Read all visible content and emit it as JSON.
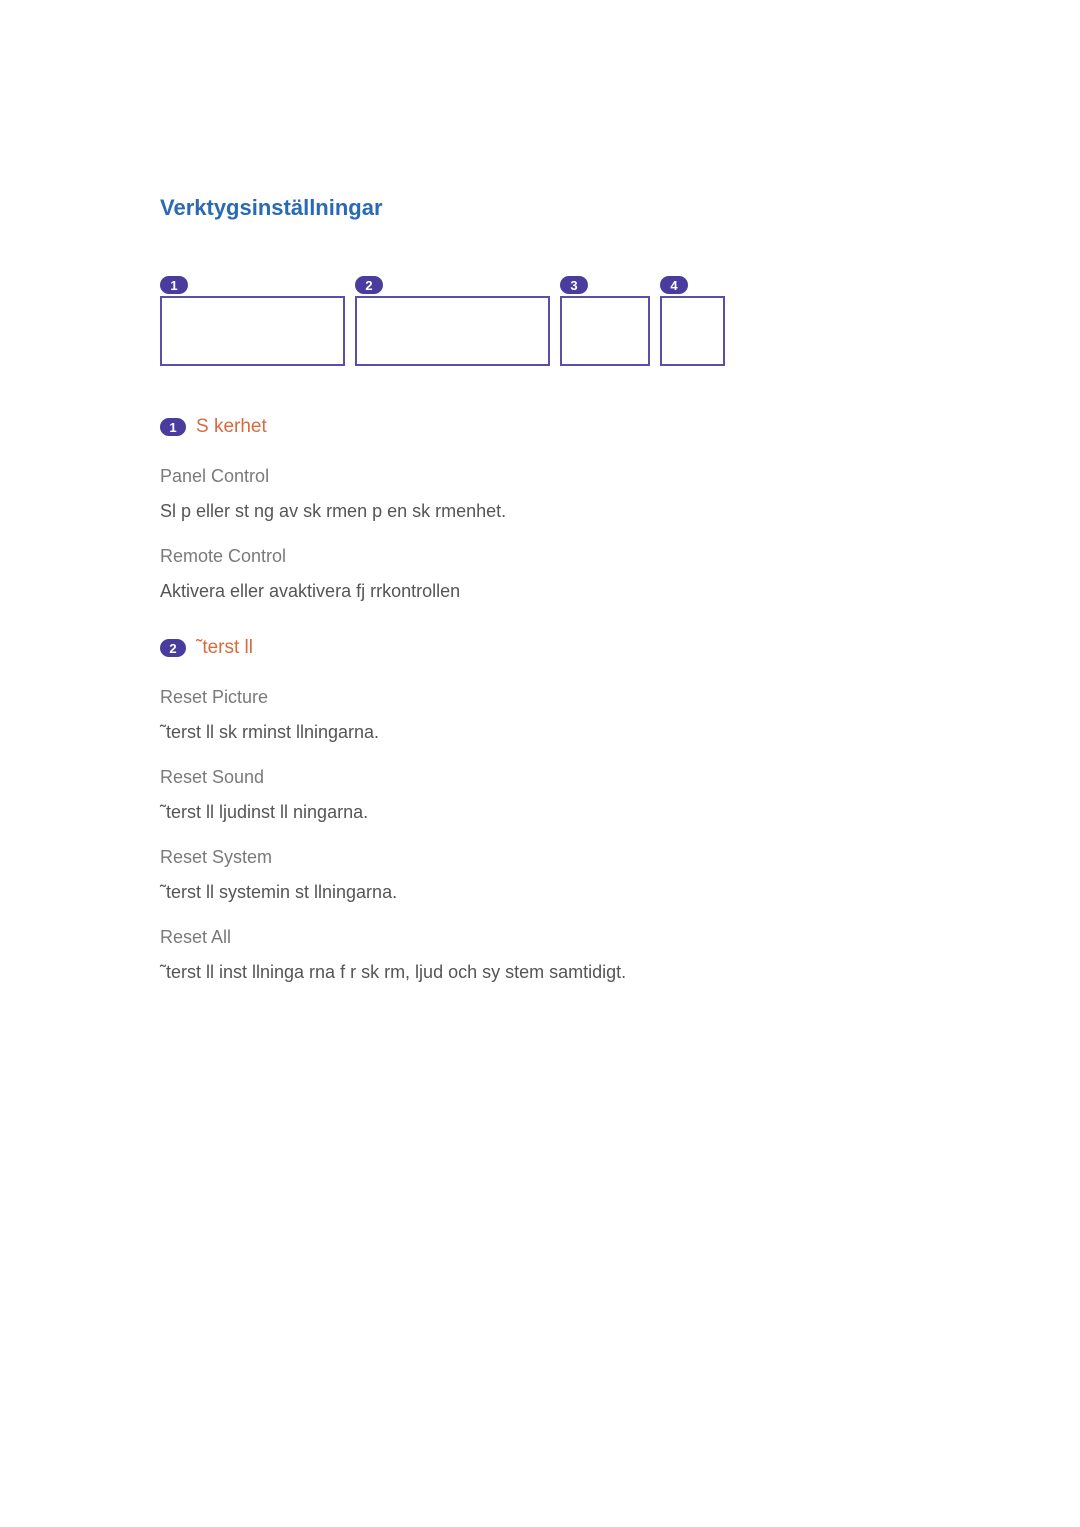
{
  "title": "Verktygsinställningar",
  "boxes": [
    {
      "num": "1"
    },
    {
      "num": "2"
    },
    {
      "num": "3"
    },
    {
      "num": "4"
    }
  ],
  "sections": [
    {
      "num": "1",
      "title": "S kerhet",
      "items": [
        {
          "title": "Panel Control",
          "desc": "Sl  p  eller st ng av sk rmen p  en sk rmenhet."
        },
        {
          "title": "Remote Control",
          "desc": "Aktivera eller avaktivera fj rrkontrollen"
        }
      ]
    },
    {
      "num": "2",
      "title": "˜terst ll",
      "items": [
        {
          "title": "Reset Picture",
          "desc": "˜terst ll sk rminst llningarna."
        },
        {
          "title": "Reset Sound",
          "desc": "˜terst ll ljudinst ll  ningarna."
        },
        {
          "title": "Reset System",
          "desc": "˜terst ll systemin st llningarna."
        },
        {
          "title": "Reset All",
          "desc": "˜terst ll inst llninga  rna f r sk rm, ljud och sy stem samtidigt."
        }
      ]
    }
  ]
}
